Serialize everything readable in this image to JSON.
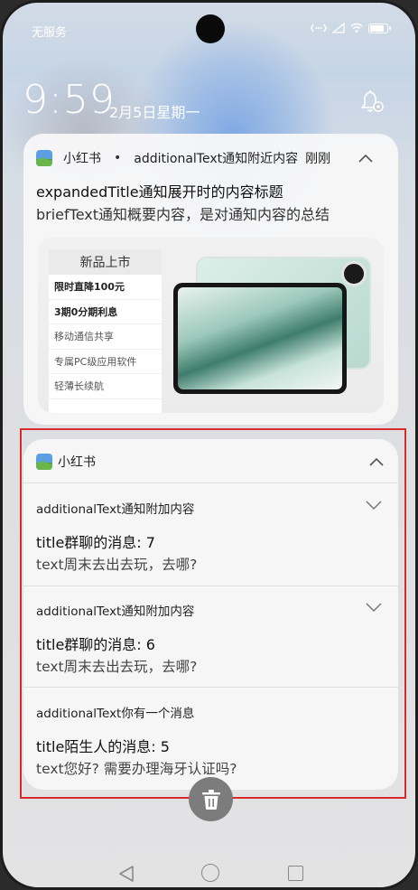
{
  "status": {
    "carrier": "无服务",
    "battery_level": 0.85
  },
  "lockscreen": {
    "time": "9:59",
    "date": "2月5日星期一"
  },
  "notification1": {
    "app_name": "小红书",
    "separator": "•",
    "additional_text": "additionalText通知附近内容",
    "time": "刚刚",
    "expanded_title": "expandedTitle通知展开时的内容标题",
    "brief_text": "briefText通知概要内容，是对通知内容的总结",
    "promo": {
      "title": "新品上市",
      "items": [
        "限时直降100元",
        "3期0分期利息",
        "移动通信共享",
        "专属PC级应用软件",
        "轻薄长续航"
      ]
    }
  },
  "group": {
    "app_name": "小红书",
    "items": [
      {
        "additional_text": "additionalText通知附加内容",
        "title": "title群聊的消息: 7",
        "text": "text周末去出去玩，去哪?"
      },
      {
        "additional_text": "additionalText通知附加内容",
        "title": "title群聊的消息:  6",
        "text": "text周末去出去玩，去哪?"
      },
      {
        "additional_text": "additionalText你有一个消息",
        "title": "title陌生人的消息: 5",
        "text": "text您好? 需要办理海牙认证吗?"
      }
    ]
  },
  "colors": {
    "highlight_border": "#d92b2b",
    "card_bg": "#f7f7f8",
    "trash_bg": "#7c7c7c"
  },
  "icons": [
    "signal-icon",
    "wifi-icon",
    "battery-icon",
    "settings-bell-icon",
    "chevron-up-icon",
    "chevron-down-icon",
    "trash-icon",
    "nav-back-icon",
    "nav-home-icon",
    "nav-recents-icon"
  ]
}
